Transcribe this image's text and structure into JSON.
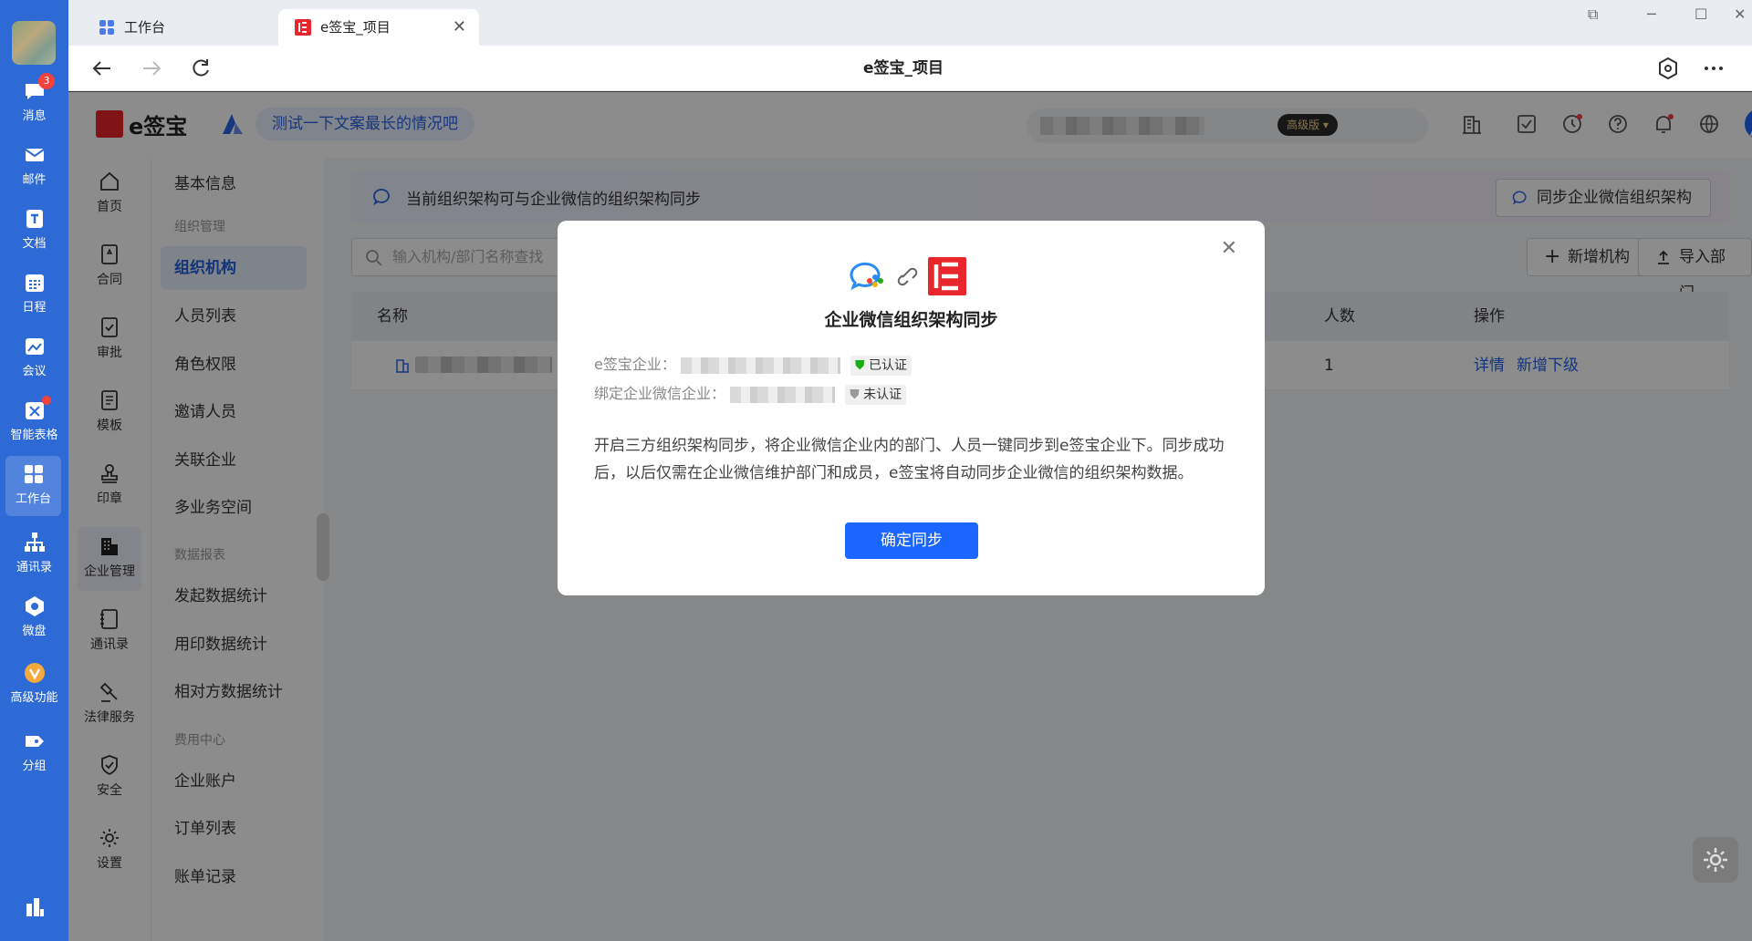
{
  "rail": {
    "items": [
      {
        "label": "消息",
        "badge": "3"
      },
      {
        "label": "邮件"
      },
      {
        "label": "文档"
      },
      {
        "label": "日程"
      },
      {
        "label": "会议"
      },
      {
        "label": "智能表格"
      },
      {
        "label": "工作台"
      },
      {
        "label": "通讯录"
      },
      {
        "label": "微盘"
      },
      {
        "label": "高级功能"
      },
      {
        "label": "分组"
      }
    ]
  },
  "browser": {
    "tabs": [
      {
        "label": "工作台"
      },
      {
        "label": "e签宝_项目"
      }
    ],
    "title": "e签宝_项目"
  },
  "app": {
    "logo_text": "e签宝",
    "slogan": "测试一下文案最长的情况吧",
    "vip_label": "高级版",
    "side_icons": [
      {
        "label": "首页"
      },
      {
        "label": "合同"
      },
      {
        "label": "审批"
      },
      {
        "label": "模板"
      },
      {
        "label": "印章"
      },
      {
        "label": "企业管理"
      },
      {
        "label": "通讯录"
      },
      {
        "label": "法律服务"
      },
      {
        "label": "安全"
      },
      {
        "label": "设置"
      }
    ],
    "menu": {
      "basic": "基本信息",
      "group_org": "组织管理",
      "org": "组织机构",
      "members": "人员列表",
      "roles": "角色权限",
      "invite": "邀请人员",
      "related": "关联企业",
      "multi": "多业务空间",
      "group_data": "数据报表",
      "stat_start": "发起数据统计",
      "stat_seal": "用印数据统计",
      "stat_counter": "相对方数据统计",
      "group_fee": "费用中心",
      "account": "企业账户",
      "orders": "订单列表",
      "bills": "账单记录"
    },
    "main": {
      "info_text": "当前组织架构可与企业微信的组织架构同步",
      "sync_button": "同步企业微信组织架构",
      "search_placeholder": "输入机构/部门名称查找",
      "add_org": "新增机构",
      "import_dept": "导入部门",
      "table": {
        "col_name": "名称",
        "col_count": "人数",
        "col_action": "操作",
        "row": {
          "count": "1",
          "detail": "详情",
          "add_child": "新增下级"
        }
      }
    }
  },
  "modal": {
    "title": "企业微信组织架构同步",
    "esign_label": "e签宝企业：",
    "esign_status": "已认证",
    "wecom_label": "绑定企业微信企业：",
    "wecom_status": "未认证",
    "description": "开启三方组织架构同步，将企业微信企业内的部门、人员一键同步到e签宝企业下。同步成功后，以后仅需在企业微信维护部门和成员，e签宝将自动同步企业微信的组织架构数据。",
    "confirm": "确定同步"
  },
  "colors": {
    "primary": "#1a66ff",
    "rail": "#2e6ad6",
    "brand_red": "#e8262b"
  }
}
